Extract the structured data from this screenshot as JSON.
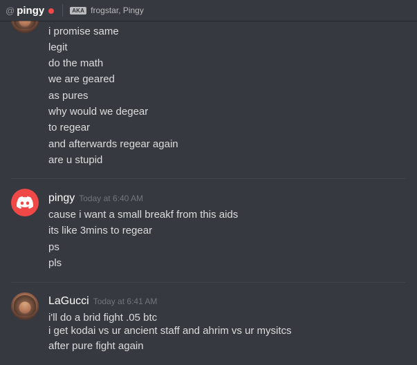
{
  "header": {
    "at_symbol": "@",
    "channel_name": "pingy",
    "status_color": "#f04747",
    "aka_label": "AKA",
    "aka_names": "frogstar, Pingy"
  },
  "groups": [
    {
      "author": "",
      "timestamp": "",
      "lines": [
        "i promise same",
        "legit",
        "do the math",
        "we are geared",
        "as pures",
        "why would we degear",
        "to regear",
        "and afterwards regear again",
        "are u stupid"
      ]
    },
    {
      "author": "pingy",
      "timestamp": "Today at 6:40 AM",
      "lines": [
        "cause i want a small breakf from this aids",
        "its like 3mins to regear",
        "ps",
        "pls"
      ]
    },
    {
      "author": "LaGucci",
      "timestamp": "Today at 6:41 AM",
      "lines": [
        "i'll do a brid fight .05 btc",
        "i get kodai vs ur ancient staff and ahrim vs ur mysitcs",
        "after pure fight again"
      ]
    }
  ],
  "colors": {
    "background": "#36393f",
    "text": "#dcddde",
    "username": "#ffffff",
    "timestamp": "#72767d",
    "discord_avatar": "#f04747"
  },
  "icons": {
    "discord_avatar": "discord-logo-icon",
    "photo_avatar": "user-photo"
  }
}
